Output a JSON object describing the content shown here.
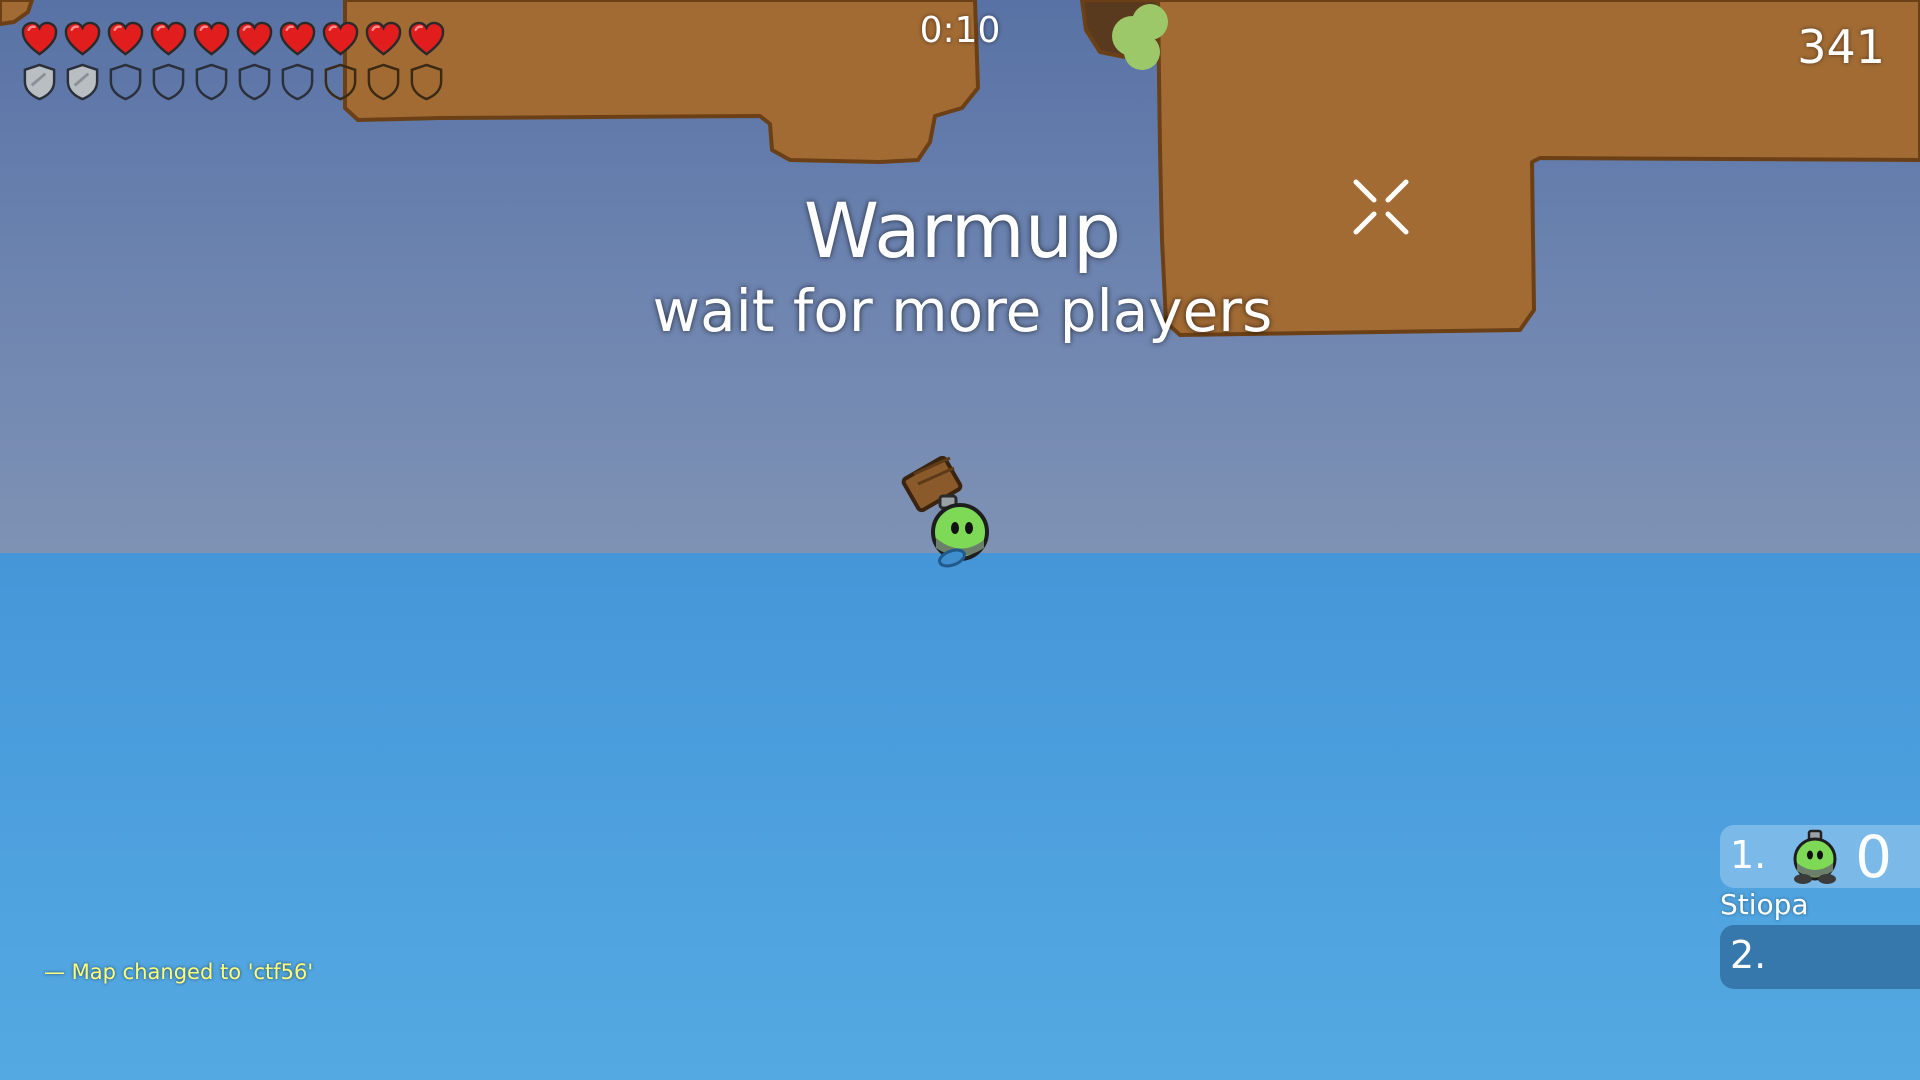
{
  "hud": {
    "health": {
      "current": 10,
      "max": 10
    },
    "armor": {
      "current": 2,
      "max": 10
    },
    "timer": "0:10",
    "score": "341"
  },
  "announcement": {
    "title": "Warmup",
    "subtitle": "wait for more players"
  },
  "chat": {
    "messages": [
      {
        "text": "— Map changed to 'ctf56'"
      }
    ]
  },
  "scoreboard": [
    {
      "rank": "1.",
      "score": "0",
      "name": "Stiopa"
    },
    {
      "rank": "2.",
      "score": "",
      "name": ""
    }
  ],
  "colors": {
    "heart": "#e11d1d",
    "armor_filled": "#b9bec3",
    "terrain": "#a26b34",
    "sky": "#6d84b0",
    "water": "#4aa0dd",
    "tee": "#7ed957",
    "chat": "#ffff7a"
  },
  "icons": {
    "health": "heart-icon",
    "armor": "shield-icon",
    "crosshair": "crosshair-icon",
    "player": "tee-character",
    "weapon": "hammer-icon"
  }
}
